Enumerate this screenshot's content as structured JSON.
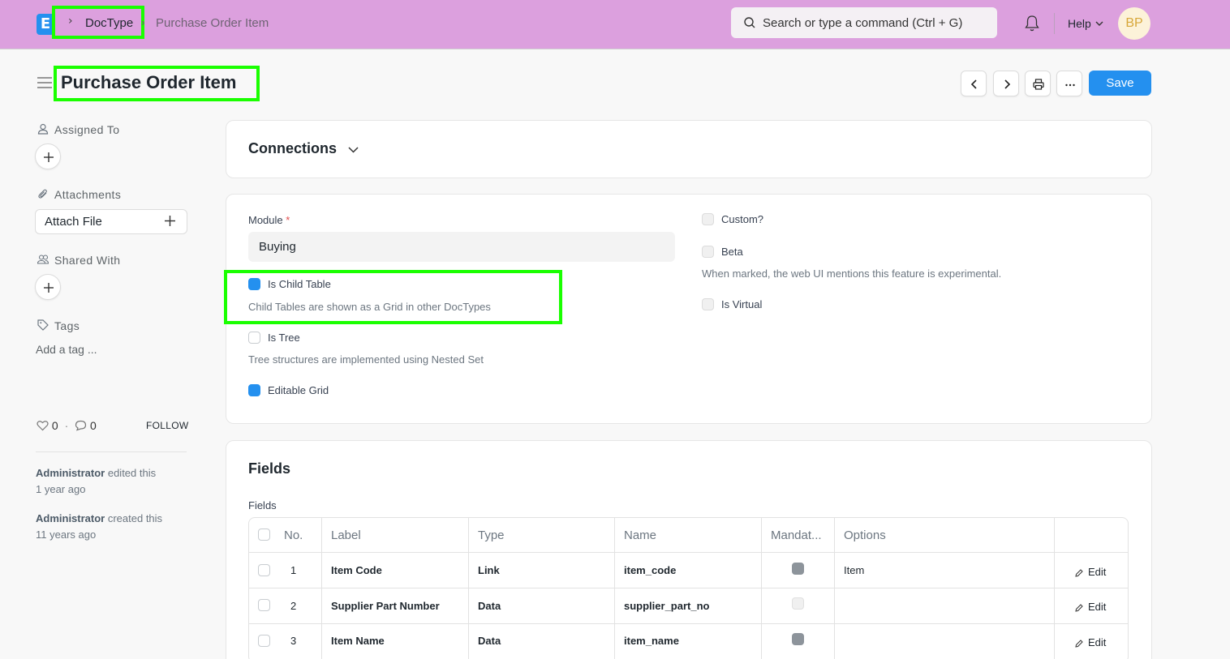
{
  "navbar": {
    "logo_text": "E",
    "breadcrumb": {
      "doctype": "DocType",
      "separator": "›",
      "current": "Purchase Order Item"
    },
    "search": {
      "placeholder": "Search or type a command (Ctrl + G)"
    },
    "help_label": "Help",
    "avatar_initials": "BP"
  },
  "page": {
    "title": "Purchase Order Item",
    "save_label": "Save",
    "more_label": "···"
  },
  "sidebar": {
    "assigned_to": "Assigned To",
    "attachments": "Attachments",
    "attach_file": "Attach File",
    "shared_with": "Shared With",
    "tags": "Tags",
    "add_tag": "Add a tag ...",
    "likes_count": "0",
    "comments_count": "0",
    "dot": "·",
    "follow": "FOLLOW",
    "activity": [
      {
        "user": "Administrator",
        "action": " edited this",
        "time": "1 year ago"
      },
      {
        "user": "Administrator",
        "action": " created this",
        "time": "11 years ago"
      }
    ]
  },
  "connections": {
    "title": "Connections"
  },
  "settings": {
    "module_label": "Module",
    "required_mark": "*",
    "module_value": "Buying",
    "is_child_table": {
      "label": "Is Child Table",
      "checked": true,
      "description": "Child Tables are shown as a Grid in other DocTypes"
    },
    "is_tree": {
      "label": "Is Tree",
      "checked": false,
      "description": "Tree structures are implemented using Nested Set"
    },
    "editable_grid": {
      "label": "Editable Grid",
      "checked": true
    },
    "custom": {
      "label": "Custom?",
      "checked": false
    },
    "beta": {
      "label": "Beta",
      "checked": false,
      "description": "When marked, the web UI mentions this feature is experimental."
    },
    "is_virtual": {
      "label": "Is Virtual",
      "checked": false
    }
  },
  "fields": {
    "section_title": "Fields",
    "table_label": "Fields",
    "headers": [
      "No.",
      "Label",
      "Type",
      "Name",
      "Mandat...",
      "Options"
    ],
    "rows": [
      {
        "no": "1",
        "label": "Item Code",
        "type": "Link",
        "name": "item_code",
        "mandatory": true,
        "options": "Item",
        "edit": "Edit"
      },
      {
        "no": "2",
        "label": "Supplier Part Number",
        "type": "Data",
        "name": "supplier_part_no",
        "mandatory": false,
        "options": "",
        "edit": "Edit"
      },
      {
        "no": "3",
        "label": "Item Name",
        "type": "Data",
        "name": "item_name",
        "mandatory": true,
        "options": "",
        "edit": "Edit"
      }
    ]
  },
  "colors": {
    "navbar": "#dca0de",
    "primary": "#2490ef",
    "highlight": "#1aff00"
  }
}
